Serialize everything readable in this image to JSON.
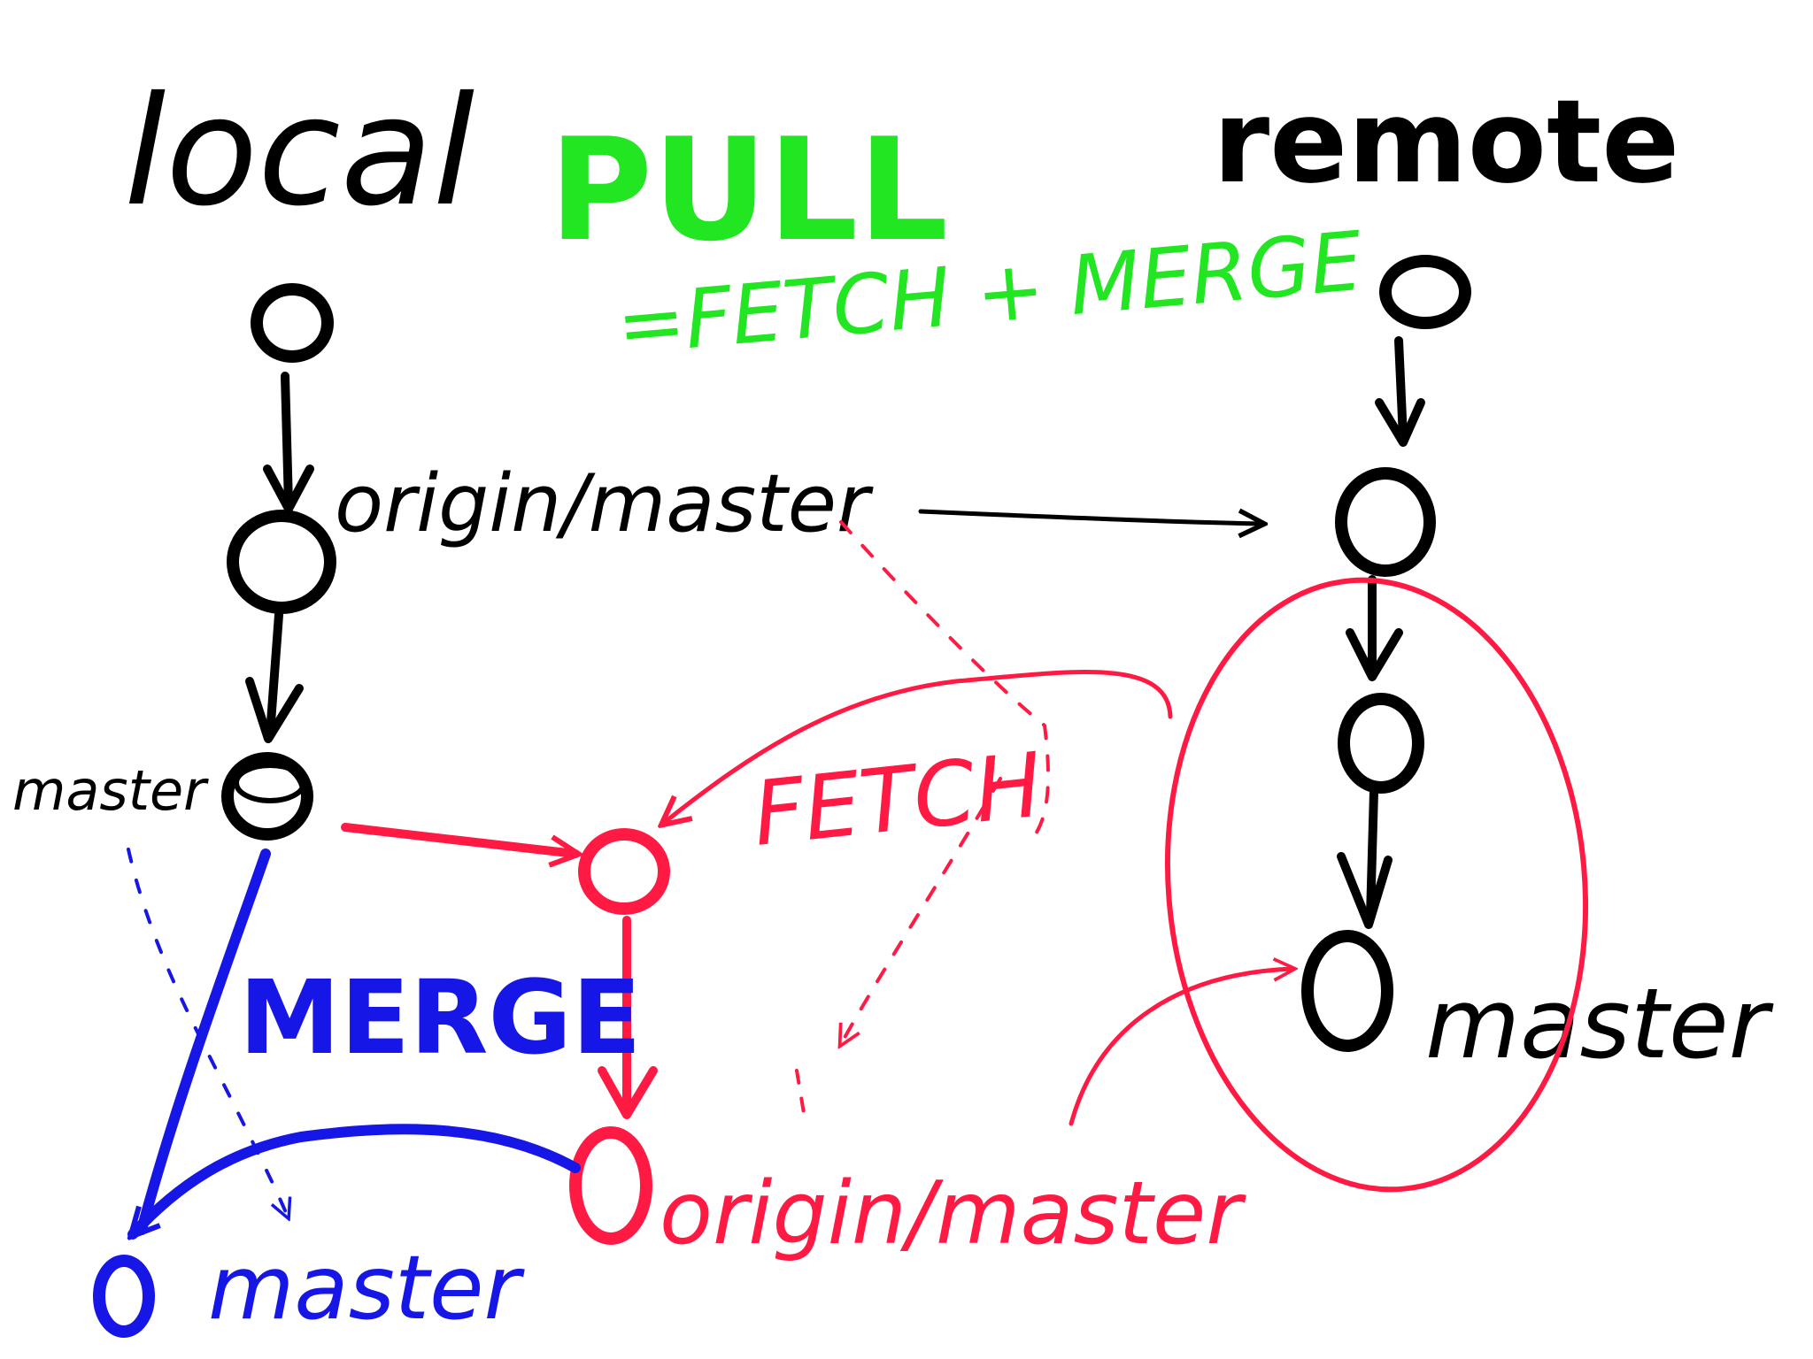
{
  "headings": {
    "local": "local",
    "remote": "remote",
    "pull": "PULL",
    "pull_formula": "=FETCH + MERGE"
  },
  "local_branch": {
    "origin_master_label": "origin/master",
    "master_label": "master"
  },
  "remote_branch": {
    "master_label": "master"
  },
  "fetch": {
    "label": "FETCH",
    "origin_master_label": "origin/master"
  },
  "merge": {
    "label": "MERGE",
    "master_label": "master"
  },
  "colors": {
    "ink": "#000000",
    "pull": "#22e622",
    "fetch": "#ff1a44",
    "merge": "#1616e6"
  }
}
